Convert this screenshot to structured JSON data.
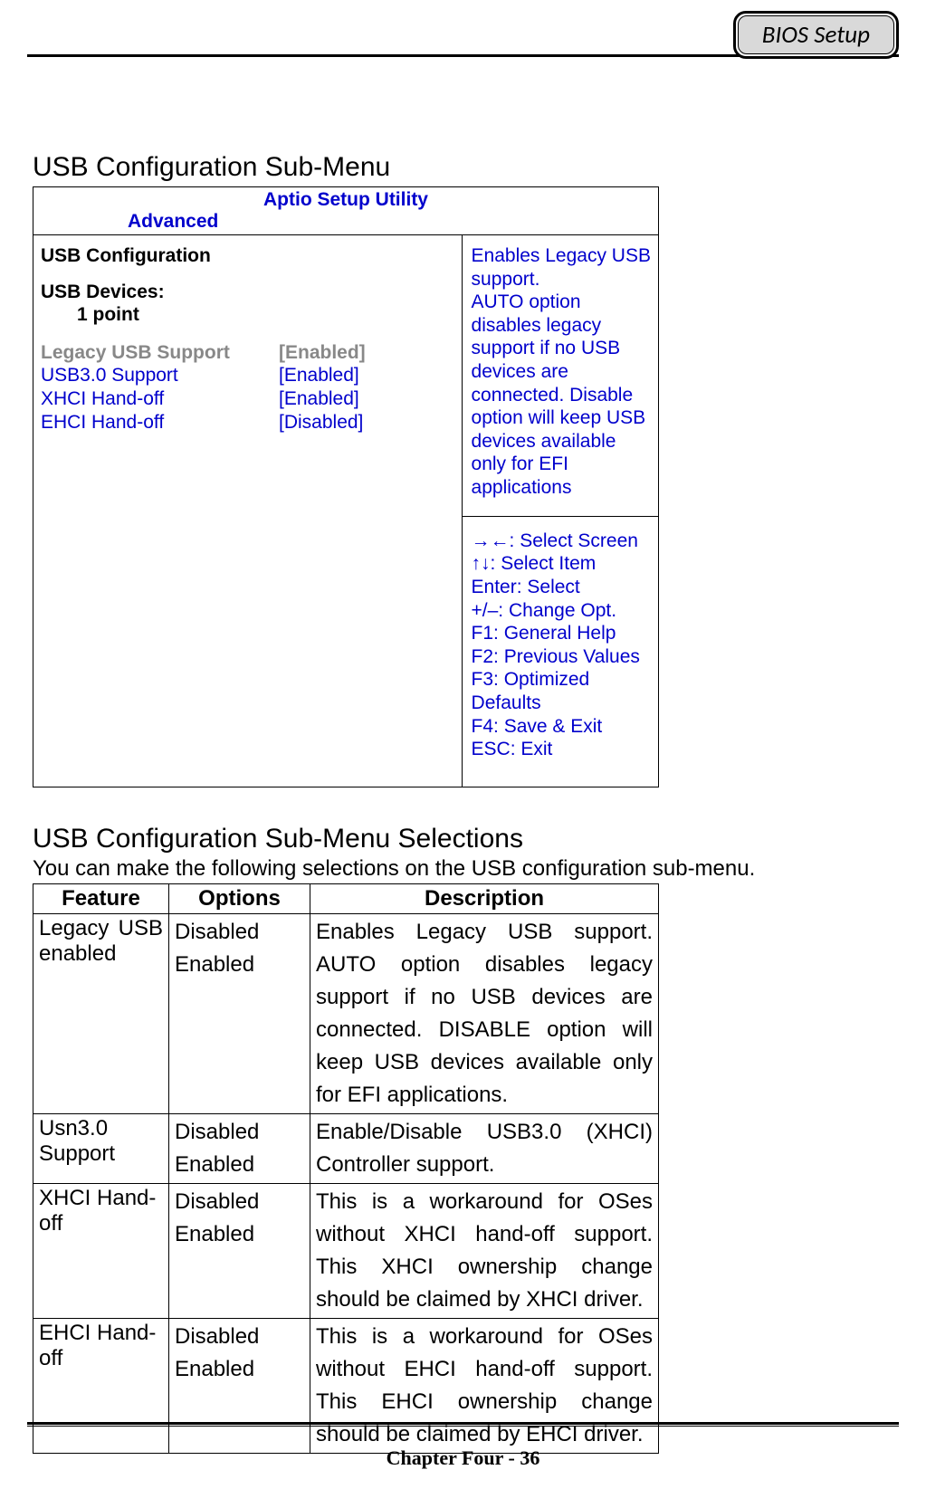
{
  "header": {
    "badge": "BIOS Setup"
  },
  "section1": {
    "title": "USB Configuration Sub-Menu",
    "bios": {
      "utility_title": "Aptio Setup Utility",
      "tab": "Advanced",
      "panel_heading": "USB Configuration",
      "devices_label": "USB Devices:",
      "devices_value": "1 point",
      "settings": [
        {
          "label": "Legacy USB Support",
          "value": "[Enabled]",
          "style": "grey"
        },
        {
          "label": "USB3.0 Support",
          "value": "[Enabled]",
          "style": "blue"
        },
        {
          "label": "XHCI Hand-off",
          "value": "[Enabled]",
          "style": "blue"
        },
        {
          "label": "EHCI Hand-off",
          "value": "[Disabled]",
          "style": "blue"
        }
      ],
      "help_line1": "Enables    Legacy    USB",
      "help_rest": "support.\nAUTO option disables legacy support if no USB devices are connected. Disable option will keep USB devices available only for EFI applications",
      "nav": "→←: Select Screen\n↑↓: Select Item\nEnter: Select\n+/–: Change Opt.\nF1: General Help\nF2: Previous Values\nF3: Optimized Defaults\nF4: Save & Exit\nESC: Exit"
    }
  },
  "section2": {
    "title": "USB Configuration Sub-Menu Selections",
    "intro": "You can make the following selections on the USB configuration sub-menu.",
    "header_feature": "Feature",
    "header_options": "Options",
    "header_description": "Description",
    "rows": [
      {
        "feature": "Legacy USB enabled",
        "feature_html": "Legacy USB",
        "feature_line2": "enabled",
        "opts": "Disabled\nEnabled",
        "desc": "Enables Legacy USB support. AUTO option disables legacy support if no USB devices are connected. DISABLE option will keep USB devices available only for EFI applications."
      },
      {
        "feature": "Usn3.0 Support",
        "opts": "Disabled\nEnabled",
        "desc": "Enable/Disable USB3.0 (XHCI) Controller support."
      },
      {
        "feature": "XHCI Hand-off",
        "opts": "Disabled\nEnabled",
        "desc": "This is a workaround for OSes without XHCI hand-off support. This XHCI ownership change should be claimed by XHCI driver."
      },
      {
        "feature": "EHCI Hand-off",
        "opts": "Disabled\nEnabled",
        "desc": "This is a workaround for OSes without EHCI hand-off support. This EHCI ownership change should be claimed by EHCI driver."
      }
    ]
  },
  "footer": {
    "text": "Chapter Four - 36"
  }
}
